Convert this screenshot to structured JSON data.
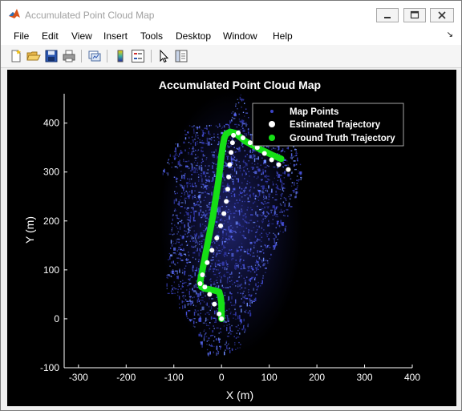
{
  "window": {
    "title": "Accumulated Point Cloud Map"
  },
  "menu": {
    "items": [
      "File",
      "Edit",
      "View",
      "Insert",
      "Tools",
      "Desktop",
      "Window",
      "Help"
    ],
    "overflow_arrow": "↘"
  },
  "toolbar": {
    "icons": [
      "new-figure-icon",
      "open-file-icon",
      "save-icon",
      "print-icon",
      "link-plot-icon",
      "colorbar-icon",
      "legend-icon",
      "pointer-icon",
      "property-editor-icon"
    ]
  },
  "colors": {
    "figure_background": "#000000",
    "map_points": "#3d45c8",
    "estimated_trajectory": "#ffffff",
    "ground_truth_trajectory": "#16e016"
  },
  "chart_data": {
    "type": "scatter",
    "title": "Accumulated Point Cloud Map",
    "xlabel": "X (m)",
    "ylabel": "Y (m)",
    "xlim": [
      -330,
      400
    ],
    "ylim": [
      -100,
      460
    ],
    "xticks": [
      -300,
      -200,
      -100,
      0,
      100,
      200,
      300,
      400
    ],
    "yticks": [
      -100,
      0,
      100,
      200,
      300,
      400
    ],
    "xtick_labels": [
      "-300",
      "-200",
      "-100",
      "0",
      "100",
      "200",
      "300",
      "400"
    ],
    "ytick_labels": [
      "-100",
      "0",
      "100",
      "200",
      "300",
      "400"
    ],
    "grid": false,
    "legend_position": "top-right",
    "series": [
      {
        "name": "Map Points",
        "kind": "dense point cloud",
        "outline": [
          [
            -130,
            295
          ],
          [
            -80,
            395
          ],
          [
            10,
            400
          ],
          [
            40,
            465
          ],
          [
            60,
            400
          ],
          [
            140,
            390
          ],
          [
            170,
            300
          ],
          [
            140,
            200
          ],
          [
            100,
            120
          ],
          [
            70,
            30
          ],
          [
            40,
            -60
          ],
          [
            -30,
            -75
          ],
          [
            -70,
            0
          ],
          [
            -120,
            60
          ],
          [
            -110,
            180
          ],
          [
            -100,
            300
          ]
        ]
      },
      {
        "name": "Estimated Trajectory",
        "points": [
          [
            0,
            0
          ],
          [
            -5,
            10
          ],
          [
            -15,
            30
          ],
          [
            -25,
            50
          ],
          [
            -35,
            65
          ],
          [
            -45,
            72
          ],
          [
            -40,
            90
          ],
          [
            -30,
            115
          ],
          [
            -20,
            140
          ],
          [
            -10,
            165
          ],
          [
            -2,
            190
          ],
          [
            5,
            215
          ],
          [
            10,
            240
          ],
          [
            13,
            265
          ],
          [
            15,
            290
          ],
          [
            17,
            315
          ],
          [
            20,
            340
          ],
          [
            23,
            360
          ],
          [
            25,
            375
          ],
          [
            35,
            380
          ],
          [
            45,
            370
          ],
          [
            60,
            360
          ],
          [
            75,
            350
          ],
          [
            90,
            338
          ],
          [
            105,
            325
          ],
          [
            120,
            315
          ],
          [
            140,
            305
          ]
        ]
      },
      {
        "name": "Ground Truth Trajectory",
        "points": [
          [
            0,
            0
          ],
          [
            0,
            15
          ],
          [
            0,
            30
          ],
          [
            -2,
            45
          ],
          [
            -5,
            55
          ],
          [
            -15,
            58
          ],
          [
            -25,
            60
          ],
          [
            -35,
            62
          ],
          [
            -42,
            65
          ],
          [
            -45,
            75
          ],
          [
            -42,
            90
          ],
          [
            -38,
            110
          ],
          [
            -33,
            135
          ],
          [
            -28,
            160
          ],
          [
            -23,
            185
          ],
          [
            -18,
            210
          ],
          [
            -14,
            235
          ],
          [
            -10,
            260
          ],
          [
            -6,
            285
          ],
          [
            -3,
            310
          ],
          [
            0,
            335
          ],
          [
            3,
            355
          ],
          [
            6,
            370
          ],
          [
            10,
            378
          ],
          [
            18,
            382
          ],
          [
            28,
            380
          ],
          [
            38,
            372
          ],
          [
            50,
            363
          ],
          [
            65,
            355
          ],
          [
            80,
            347
          ],
          [
            95,
            340
          ],
          [
            110,
            333
          ],
          [
            125,
            327
          ]
        ]
      }
    ]
  }
}
